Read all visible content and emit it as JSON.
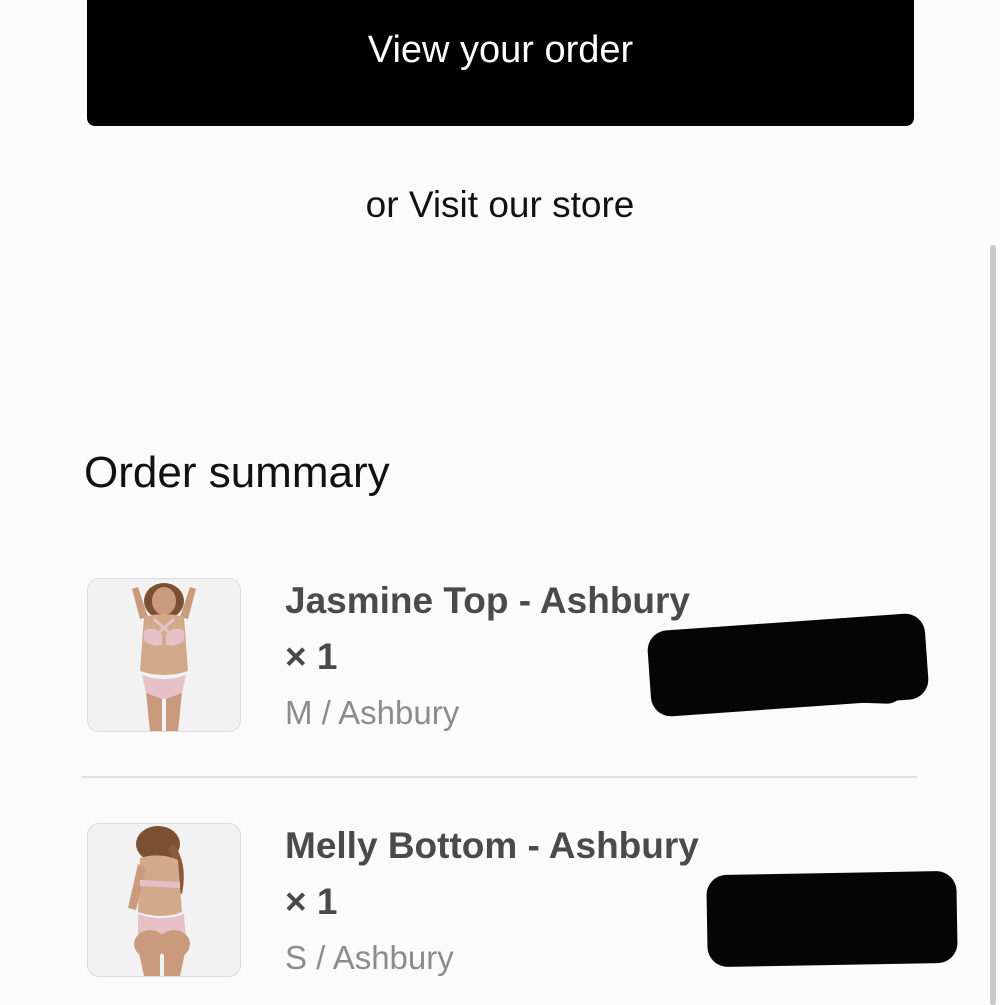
{
  "actions": {
    "view_order_label": "View your order",
    "or_text": "or",
    "visit_store_label": "Visit our store"
  },
  "order_summary": {
    "title": "Order summary",
    "items": [
      {
        "name": "Jasmine Top - Ashbury",
        "quantity": "× 1",
        "variant": "M / Ashbury",
        "image_icon": "product-photo-bikini-top"
      },
      {
        "name": "Melly Bottom - Ashbury",
        "quantity": "× 1",
        "variant": "S / Ashbury",
        "image_icon": "product-photo-bikini-bottom"
      }
    ]
  },
  "colors": {
    "button_bg": "#000000",
    "button_text": "#ffffff",
    "item_name": "#4a4a4a",
    "variant_text": "#8c8c8c",
    "swimwear_pattern": "#e6c2c8"
  }
}
